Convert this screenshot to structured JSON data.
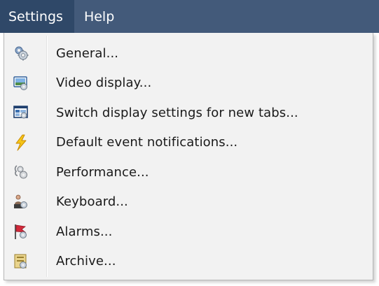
{
  "menubar": {
    "items": [
      {
        "label": "Settings",
        "active": true
      },
      {
        "label": "Help",
        "active": false
      }
    ]
  },
  "menu": {
    "items": [
      {
        "label": "General...",
        "icon": "gears-icon"
      },
      {
        "label": "Video display...",
        "icon": "video-display-icon"
      },
      {
        "label": "Switch display settings for new tabs...",
        "icon": "switch-display-icon"
      },
      {
        "label": "Default event notifications...",
        "icon": "lightning-icon"
      },
      {
        "label": "Performance...",
        "icon": "performance-gears-icon"
      },
      {
        "label": "Keyboard...",
        "icon": "keyboard-person-icon"
      },
      {
        "label": "Alarms...",
        "icon": "alarm-flag-icon"
      },
      {
        "label": "Archive...",
        "icon": "archive-icon"
      }
    ]
  },
  "colors": {
    "menubar_bg": "#435a7a",
    "menubar_active_bg": "#2f4868",
    "menu_bg": "#f2f2f2"
  }
}
